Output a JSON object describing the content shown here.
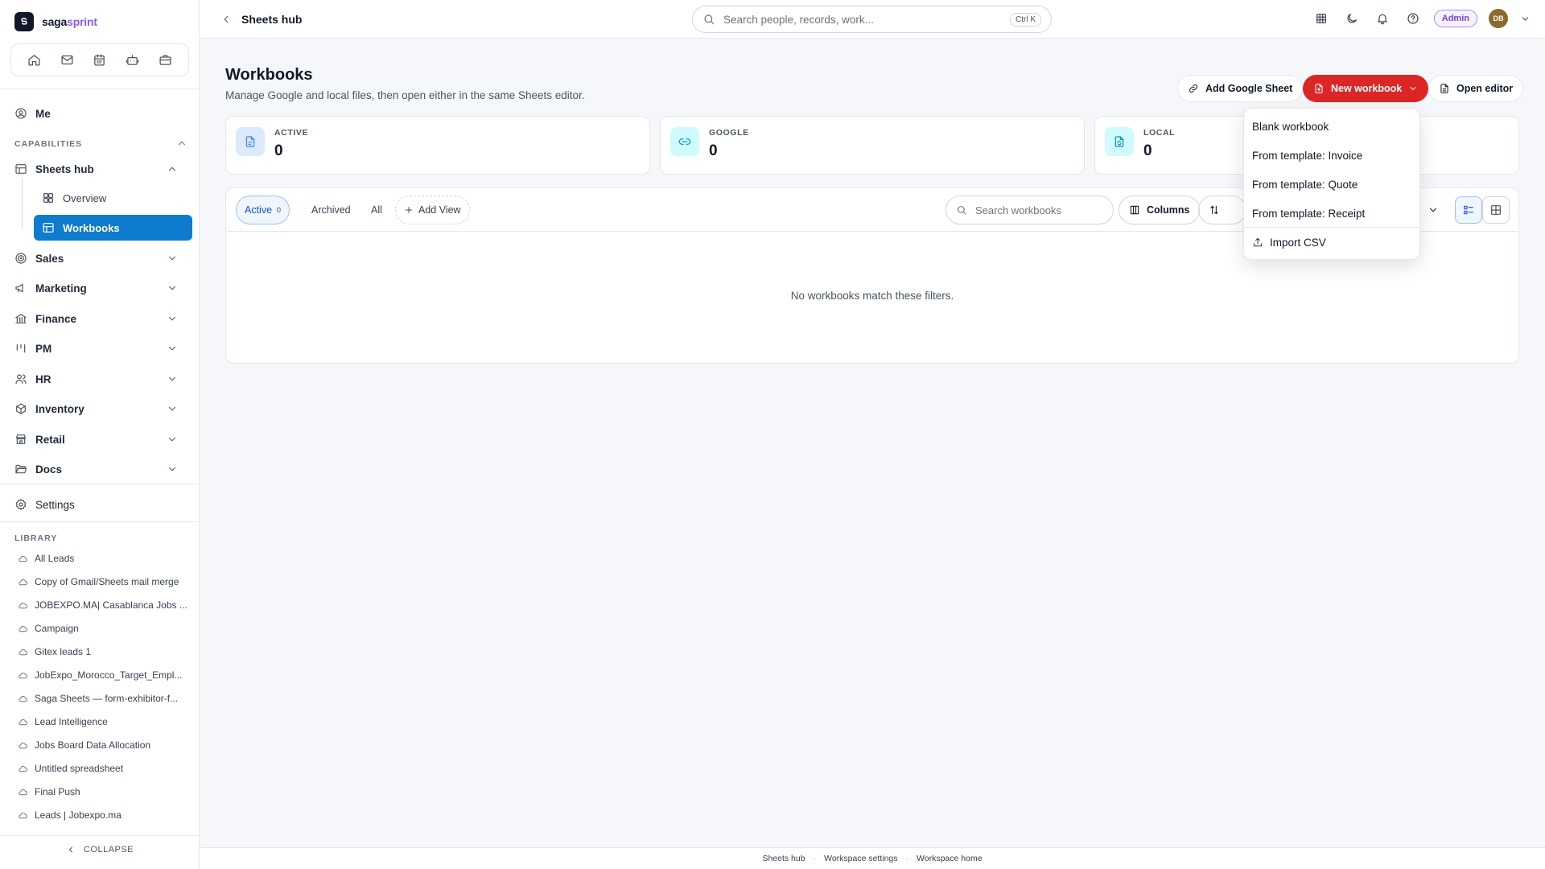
{
  "brand": {
    "name_main": "saga",
    "name_accent": "sprint"
  },
  "sidebar": {
    "me_label": "Me",
    "capabilities_label": "CAPABILITIES",
    "sheets_hub_label": "Sheets hub",
    "sub_items": [
      {
        "label": "Overview"
      },
      {
        "label": "Workbooks"
      }
    ],
    "groups": [
      {
        "label": "Sales"
      },
      {
        "label": "Marketing"
      },
      {
        "label": "Finance"
      },
      {
        "label": "PM"
      },
      {
        "label": "HR"
      },
      {
        "label": "Inventory"
      },
      {
        "label": "Retail"
      },
      {
        "label": "Docs"
      }
    ],
    "settings_label": "Settings",
    "library_label": "LIBRARY",
    "library_items": [
      {
        "label": "All Leads"
      },
      {
        "label": "Copy of Gmail/Sheets mail merge"
      },
      {
        "label": "JOBEXPO.MA| Casablanca Jobs ..."
      },
      {
        "label": "Campaign"
      },
      {
        "label": "Gitex leads 1"
      },
      {
        "label": "JobExpo_Morocco_Target_Empl..."
      },
      {
        "label": "Saga Sheets — form-exhibitor-f..."
      },
      {
        "label": "Lead Intelligence"
      },
      {
        "label": "Jobs Board Data Allocation"
      },
      {
        "label": "Untitled spreadsheet"
      },
      {
        "label": "Final Push"
      },
      {
        "label": "Leads | Jobexpo.ma"
      }
    ],
    "collapse_label": "COLLAPSE"
  },
  "topbar": {
    "back_label": "Sheets hub",
    "search_placeholder": "Search people, records, work...",
    "shortcut": "Ctrl K",
    "role_badge": "Admin",
    "avatar_initials": "DB"
  },
  "main": {
    "title": "Workbooks",
    "subtitle": "Manage Google and local files, then open either in the same Sheets editor.",
    "buttons": {
      "add_google": "Add Google Sheet",
      "new_workbook": "New workbook",
      "open_editor": "Open editor"
    },
    "stats": [
      {
        "label": "ACTIVE",
        "value": "0"
      },
      {
        "label": "GOOGLE",
        "value": "0"
      },
      {
        "label": "LOCAL",
        "value": "0"
      }
    ],
    "tabs": {
      "active": "Active",
      "active_count": "0",
      "archived": "Archived",
      "all": "All",
      "add_view": "Add View"
    },
    "search_placeholder": "Search workbooks",
    "columns_label": "Columns",
    "empty_message": "No workbooks match these filters."
  },
  "dropdown": {
    "items": [
      {
        "label": "Blank workbook"
      },
      {
        "label": "From template: Invoice"
      },
      {
        "label": "From template: Quote"
      },
      {
        "label": "From template: Receipt"
      }
    ],
    "import_label": "Import CSV"
  },
  "footer": {
    "links": [
      "Sheets hub",
      "Workspace settings",
      "Workspace home"
    ]
  },
  "colors": {
    "primary_red": "#dc2626",
    "active_blue": "#0e7bcc",
    "admin_purple": "#7c3aed"
  }
}
